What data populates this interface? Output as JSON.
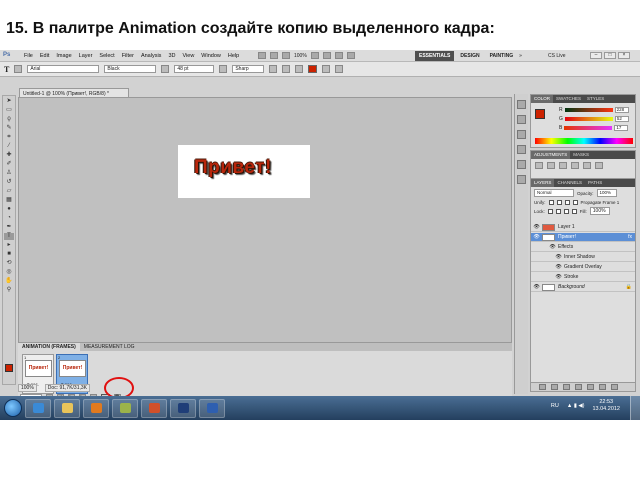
{
  "caption": "15. В палитре Animation создайте копию выделенного кадра:",
  "menubar": {
    "logo": "Ps",
    "items": [
      "File",
      "Edit",
      "Image",
      "Layer",
      "Select",
      "Filter",
      "Analysis",
      "3D",
      "View",
      "Window",
      "Help"
    ],
    "zoom": "100%",
    "workspaces": [
      "ESSENTIALS",
      "DESIGN",
      "PAINTING"
    ],
    "more": "»",
    "cs_live": "CS Live"
  },
  "options": {
    "font_family": "Arial",
    "font_style": "Black",
    "font_size": "48 pt",
    "antialias": "Sharp"
  },
  "document": {
    "tab_title": "Untitled-1 @ 100% (Привет!, RGB/8) *",
    "canvas_text": "Привет!",
    "zoom": "100%",
    "doc_info": "Doc: 91,7K/31,3K"
  },
  "animation": {
    "tabs": [
      "ANIMATION (FRAMES)",
      "MEASUREMENT LOG"
    ],
    "frames": [
      {
        "num": "1",
        "label": "Привет!",
        "delay": "0 sec."
      },
      {
        "num": "2",
        "label": "Привет!",
        "delay": "0 sec."
      }
    ],
    "loop": "Forever"
  },
  "color_panel": {
    "tabs": [
      "COLOR",
      "SWATCHES",
      "STYLES"
    ],
    "r": "228",
    "g": "52",
    "b": "17"
  },
  "adjustments_panel": {
    "tabs": [
      "ADJUSTMENTS",
      "MASKS"
    ]
  },
  "layers_panel": {
    "tabs": [
      "LAYERS",
      "CHANNELS",
      "PATHS"
    ],
    "blend_mode": "Normal",
    "opacity_label": "Opacity:",
    "opacity": "100%",
    "unify_label": "Unify:",
    "propagate_label": "Propagate Frame 1",
    "lock_label": "Lock:",
    "fill_label": "Fill:",
    "fill": "100%",
    "layers": [
      {
        "name": "Layer 1",
        "selected": false,
        "fx": false
      },
      {
        "name": "Привет!",
        "selected": true,
        "fx": true
      },
      {
        "name": "Effects",
        "selected": false,
        "fx": false
      },
      {
        "name": "Inner Shadow",
        "selected": false,
        "fx": false
      },
      {
        "name": "Gradient Overlay",
        "selected": false,
        "fx": false
      },
      {
        "name": "Stroke",
        "selected": false,
        "fx": false
      },
      {
        "name": "Background",
        "selected": false,
        "fx": false
      }
    ]
  },
  "taskbar": {
    "lang": "RU",
    "time": "22:53",
    "date": "13.04.2012"
  },
  "colors": {
    "text_red": "#b8260c",
    "selection_blue": "#5c8fd6",
    "highlight_circle": "#e01010",
    "taskbar": "#2a4a70"
  }
}
